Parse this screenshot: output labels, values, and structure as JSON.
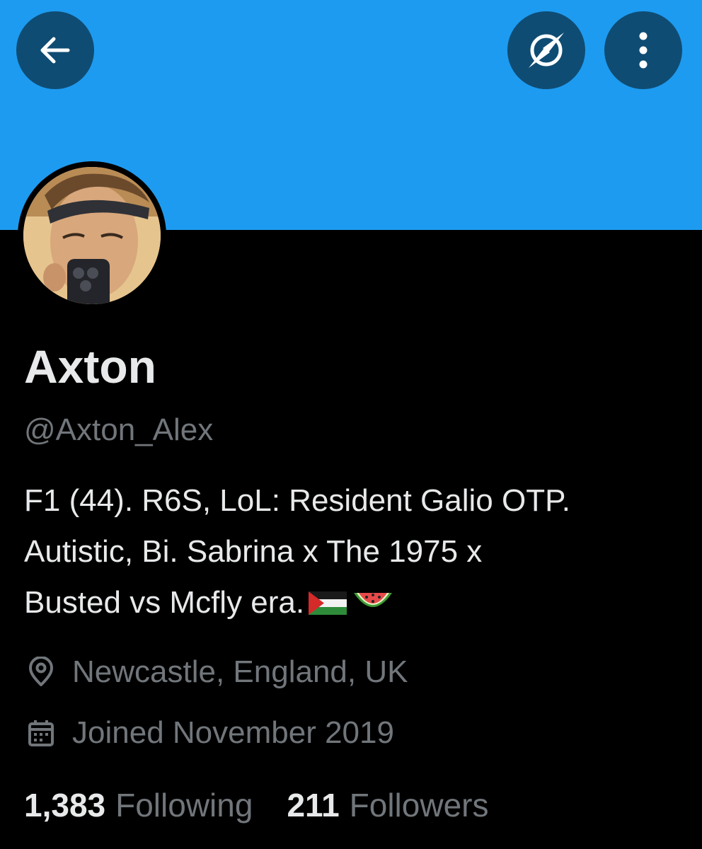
{
  "colors": {
    "banner": "#1d9bf0",
    "button_bg": "#0f4c73",
    "background": "#000000",
    "primary_text": "#e7e9ea",
    "secondary_text": "#71767b"
  },
  "header": {
    "back_icon": "arrow-left-icon",
    "explore_icon": "compass-icon",
    "more_icon": "vertical-dots-icon"
  },
  "profile": {
    "display_name": "Axton",
    "handle": "@Axton_Alex",
    "bio_lines": [
      "F1 (44). R6S, LoL: Resident Galio OTP.",
      "Autistic, Bi. Sabrina x The 1975 x",
      "Busted vs Mcfly era."
    ],
    "bio_emojis": [
      "palestine-flag-icon",
      "watermelon-icon"
    ],
    "location": "Newcastle, England, UK",
    "joined": "Joined November 2019",
    "following_count": "1,383",
    "following_label": "Following",
    "followers_count": "211",
    "followers_label": "Followers"
  }
}
